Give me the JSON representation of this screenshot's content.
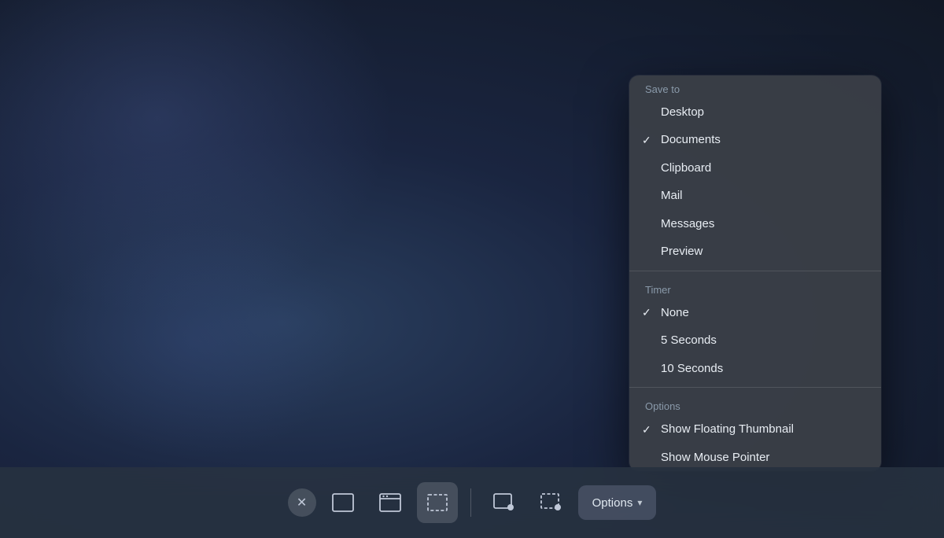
{
  "desktop": {
    "bg_color_start": "#2a3f5f",
    "bg_color_end": "#111825"
  },
  "dropdown": {
    "save_to_label": "Save to",
    "items_save": [
      {
        "label": "Desktop",
        "checked": false
      },
      {
        "label": "Documents",
        "checked": true
      },
      {
        "label": "Clipboard",
        "checked": false
      },
      {
        "label": "Mail",
        "checked": false
      },
      {
        "label": "Messages",
        "checked": false
      },
      {
        "label": "Preview",
        "checked": false
      }
    ],
    "timer_label": "Timer",
    "items_timer": [
      {
        "label": "None",
        "checked": true
      },
      {
        "label": "5 Seconds",
        "checked": false
      },
      {
        "label": "10 Seconds",
        "checked": false
      }
    ],
    "options_label": "Options",
    "items_options": [
      {
        "label": "Show Floating Thumbnail",
        "checked": true
      },
      {
        "label": "Show Mouse Pointer",
        "checked": false
      }
    ]
  },
  "toolbar": {
    "options_button_label": "Options",
    "chevron": "▾",
    "buttons": [
      {
        "name": "close",
        "label": "✕"
      },
      {
        "name": "fullscreen-capture",
        "label": ""
      },
      {
        "name": "window-capture",
        "label": ""
      },
      {
        "name": "region-capture",
        "label": ""
      },
      {
        "name": "screen-record",
        "label": ""
      },
      {
        "name": "region-record",
        "label": ""
      }
    ]
  }
}
